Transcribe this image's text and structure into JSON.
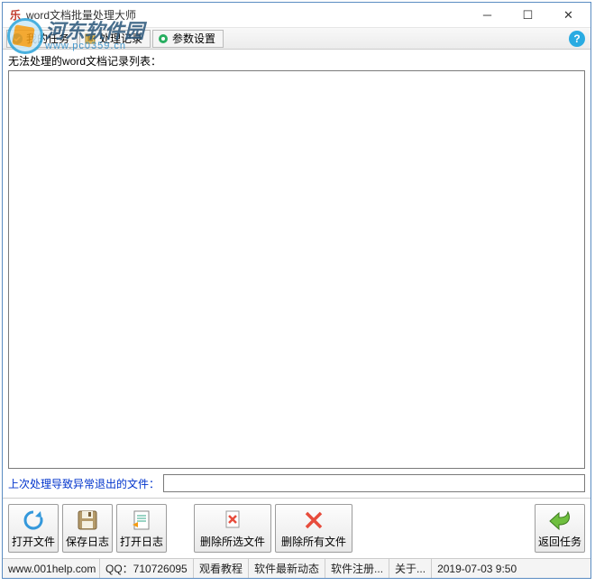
{
  "window": {
    "title": "word文档批量处理大师"
  },
  "tabs": {
    "my_tasks": "我的任务",
    "process_log": "处理记录",
    "param_settings": "参数设置"
  },
  "watermark": {
    "cn": "河东软件园",
    "en": "www.pc0359.cn"
  },
  "labels": {
    "fail_list": "无法处理的word文档记录列表：",
    "crash_file": "上次处理导致异常退出的文件："
  },
  "crash_input_value": "",
  "actions": {
    "open_file": "打开文件",
    "save_log": "保存日志",
    "open_log": "打开日志",
    "delete_selected": "删除所选文件",
    "delete_all": "删除所有文件",
    "return_task": "返回任务"
  },
  "status": {
    "website": "www.001help.com",
    "qq": "QQ：710726095",
    "tutorial": "观看教程",
    "news": "软件最新动态",
    "register": "软件注册...",
    "about": "关于...",
    "datetime": "2019-07-03  9:50"
  }
}
